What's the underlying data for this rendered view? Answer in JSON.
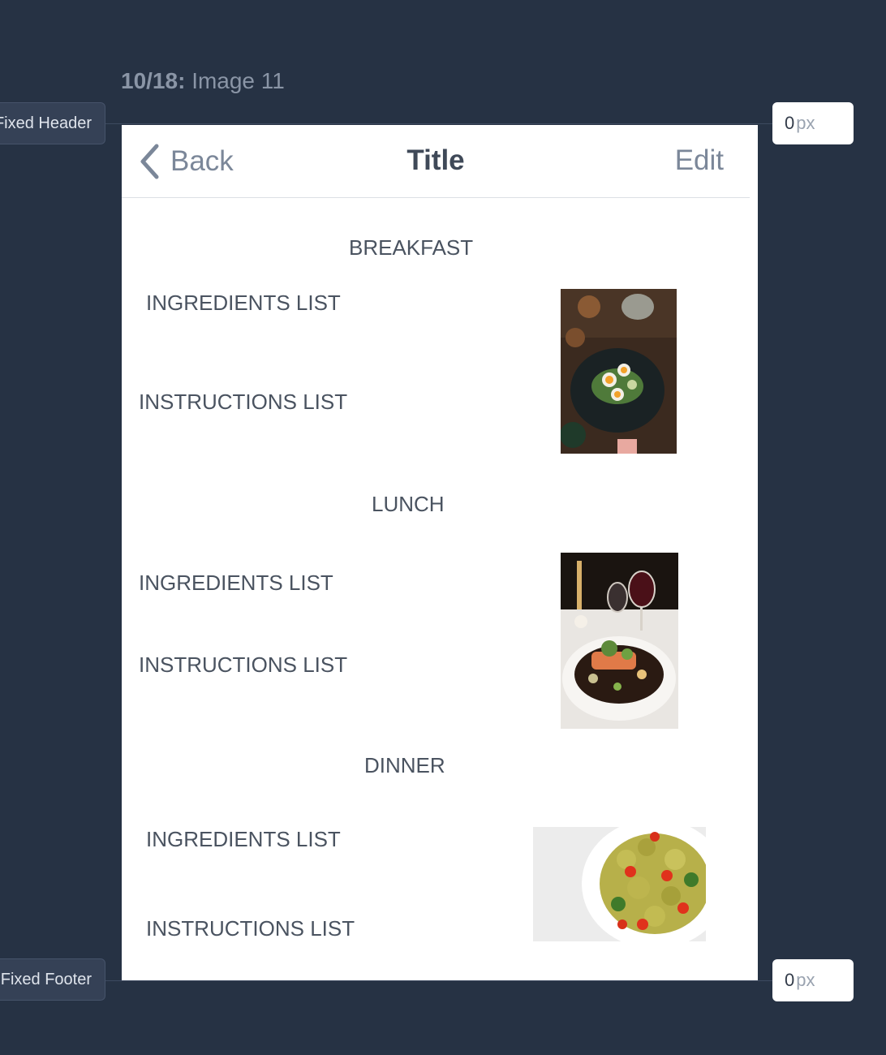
{
  "editor": {
    "screen_counter": "10/18:",
    "screen_name": "Image 11",
    "fixed_header_label": "Fixed Header",
    "fixed_footer_label": "Fixed Footer",
    "header_offset": {
      "value": "0",
      "unit": "px"
    },
    "footer_offset": {
      "value": "0",
      "unit": "px"
    }
  },
  "navbar": {
    "back_label": "Back",
    "title": "Title",
    "edit_label": "Edit",
    "back_icon": "chevron-left-icon"
  },
  "meals": [
    {
      "heading": "BREAKFAST",
      "ingredients_label": "INGREDIENTS LIST",
      "instructions_label": "INSTRUCTIONS LIST",
      "image": "breakfast-photo"
    },
    {
      "heading": "LUNCH",
      "ingredients_label": "INGREDIENTS LIST",
      "instructions_label": "INSTRUCTIONS LIST",
      "image": "lunch-photo"
    },
    {
      "heading": "DINNER",
      "ingredients_label": "INGREDIENTS LIST",
      "instructions_label": "INSTRUCTIONS LIST",
      "image": "dinner-photo"
    }
  ],
  "colors": {
    "background": "#263244",
    "accent_text": "#7b8799",
    "title_text": "#3f4958"
  }
}
